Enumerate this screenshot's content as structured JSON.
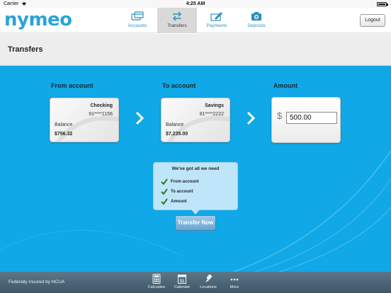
{
  "status_bar": {
    "carrier": "Carrier",
    "time": "4:25 AM"
  },
  "header": {
    "logo": "nymeo",
    "tabs": [
      {
        "label": "Accounts",
        "icon": "cards-icon"
      },
      {
        "label": "Transfers",
        "icon": "transfer-arrows-icon",
        "active": true
      },
      {
        "label": "Payments",
        "icon": "pen-check-icon"
      },
      {
        "label": "Deposits",
        "icon": "camera-icon"
      }
    ],
    "logout_label": "Logout"
  },
  "page": {
    "title": "Transfers"
  },
  "transfer": {
    "from": {
      "section_label": "From account",
      "type": "Checking",
      "number": "91****1156",
      "balance_label": "Balance",
      "balance": "$756.32"
    },
    "to": {
      "section_label": "To account",
      "type": "Savings",
      "number": "81****2222",
      "balance_label": "Balance",
      "balance": "$7,235.00"
    },
    "amount": {
      "section_label": "Amount",
      "currency_symbol": "$",
      "value": "500.00"
    },
    "checklist": {
      "title": "We've got all we need",
      "items": [
        "From account",
        "To account",
        "Amount"
      ]
    },
    "submit_label": "Transfer Now"
  },
  "footer": {
    "insured_text": "Federally Insured by NCUA",
    "tools": [
      {
        "label": "Calculator",
        "icon": "calculator-icon"
      },
      {
        "label": "Calendar",
        "icon": "calendar-icon",
        "day": "31"
      },
      {
        "label": "Locations",
        "icon": "pin-icon"
      },
      {
        "label": "More",
        "icon": "more-dots-icon"
      }
    ]
  },
  "colors": {
    "brand": "#2aa3d8",
    "main_bg": "#10a8e6",
    "footer_bg": "#4c6676"
  }
}
